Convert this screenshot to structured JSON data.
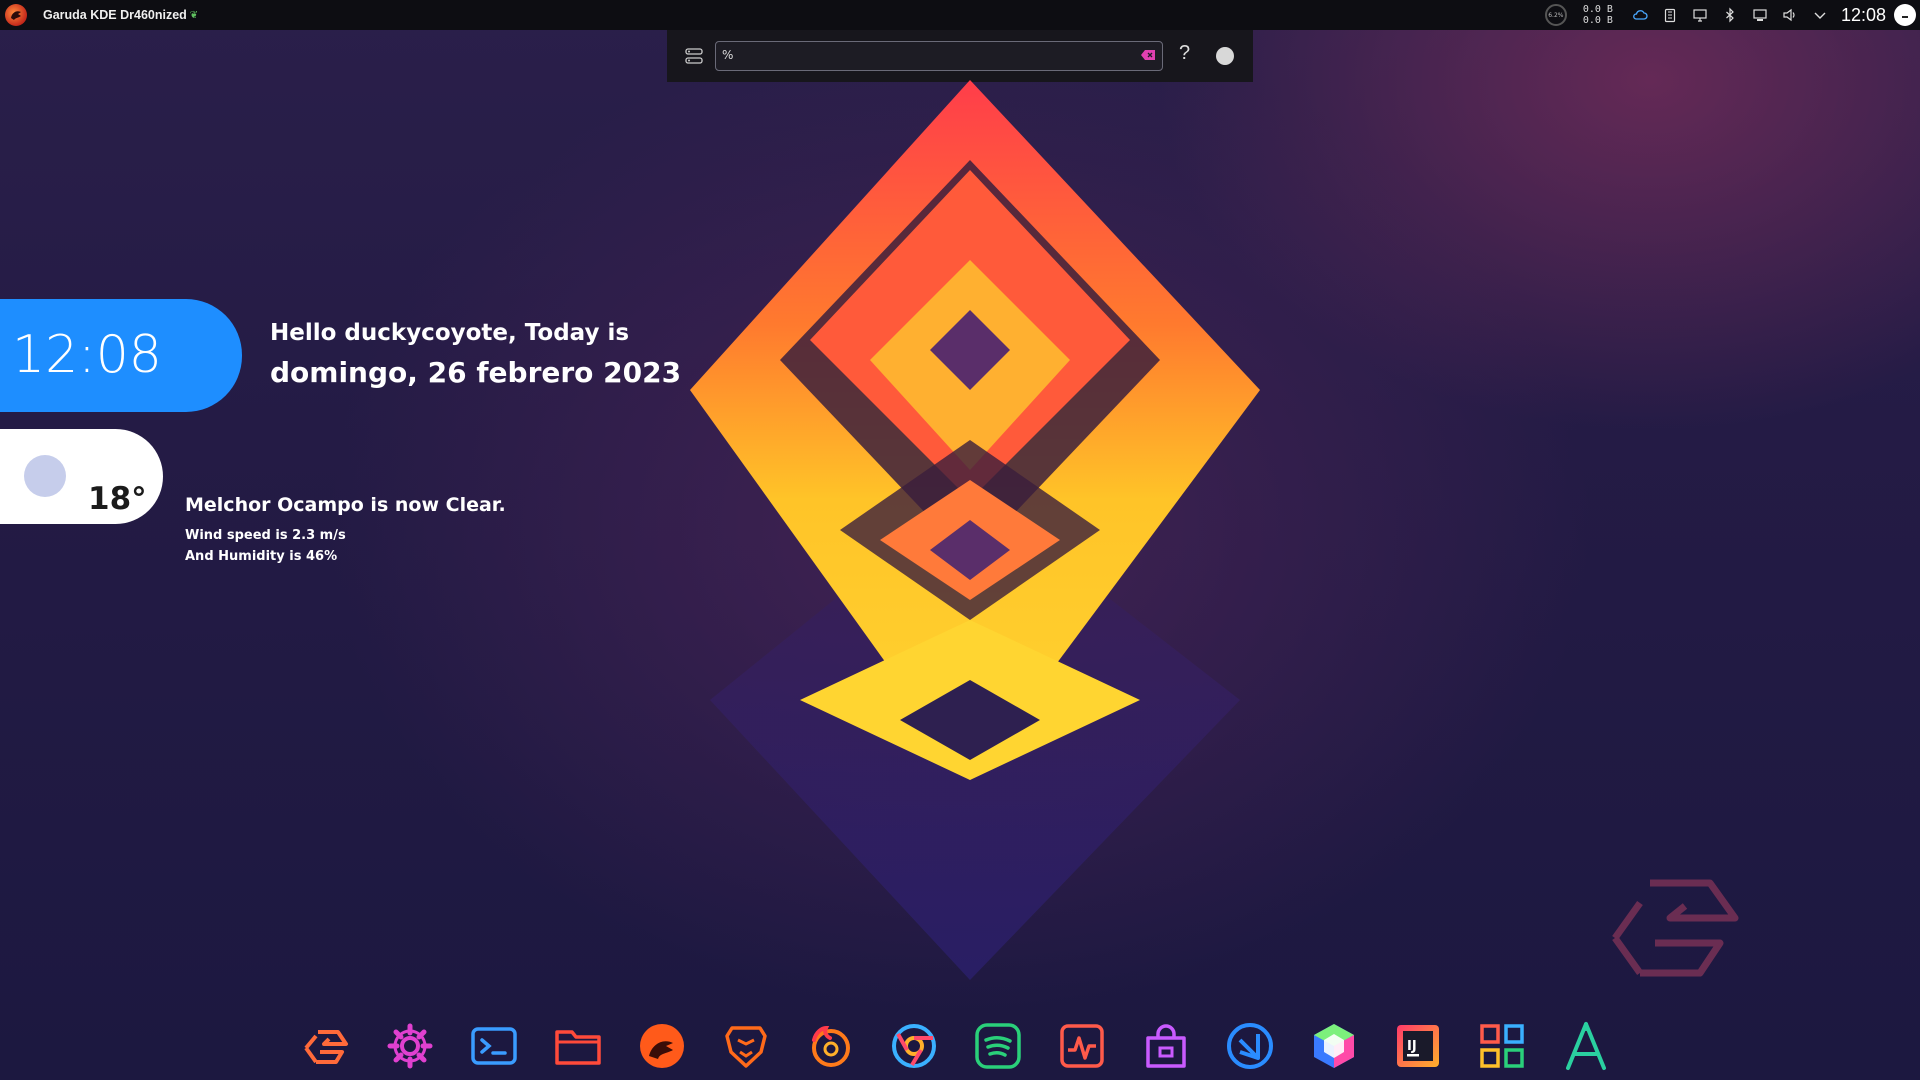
{
  "top_panel": {
    "window_title": "Garuda KDE Dr460nized",
    "cpu_label": "6.2%",
    "net_up": "0.0 B",
    "net_down": "0.0 B",
    "clock": "12:08",
    "tray_icons": [
      "weather-cloud-icon",
      "clipboard-icon",
      "display-icon",
      "bluetooth-icon",
      "network-icon",
      "volume-icon",
      "chevron-down-icon"
    ]
  },
  "krunner": {
    "query": "%",
    "help_label": "?"
  },
  "clock_widget": {
    "time": "12:08",
    "greeting": "Hello duckycoyote, Today is",
    "date": "domingo, 26 febrero 2023"
  },
  "weather_widget": {
    "temperature": "18°",
    "headline": "Melchor Ocampo is now Clear.",
    "wind": "Wind speed is 2.3 m/s",
    "humidity": "And Humidity is 46%"
  },
  "dock": {
    "items": [
      "garuda-welcome-icon",
      "settings-icon",
      "terminal-icon",
      "file-manager-icon",
      "garuda-dragon-icon",
      "brave-icon",
      "firefox-icon",
      "chrome-icon",
      "spotify-icon",
      "system-monitor-icon",
      "software-store-icon",
      "vscode-icon",
      "virtualbox-icon",
      "intellij-icon",
      "app-launcher-grid-icon",
      "kate-icon"
    ]
  },
  "colors": {
    "clock_pill": "#1e8eff",
    "panel_bg": "#0d0d12",
    "accent_pink": "#e040b0"
  }
}
